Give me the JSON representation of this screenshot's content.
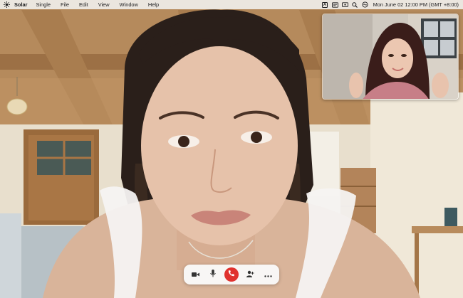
{
  "menubar": {
    "app_name": "Solar",
    "menus": [
      "Single",
      "File",
      "Edit",
      "View",
      "Window",
      "Help"
    ],
    "input_source": "A",
    "clock": "Mon June 02  12:00 PM (GMT +8:00)"
  },
  "call": {
    "controls": [
      {
        "icon": "camera-icon"
      },
      {
        "icon": "microphone-icon"
      },
      {
        "icon": "end-call-icon",
        "color": "#e0312e"
      },
      {
        "icon": "add-person-icon"
      },
      {
        "icon": "more-icon"
      }
    ]
  }
}
